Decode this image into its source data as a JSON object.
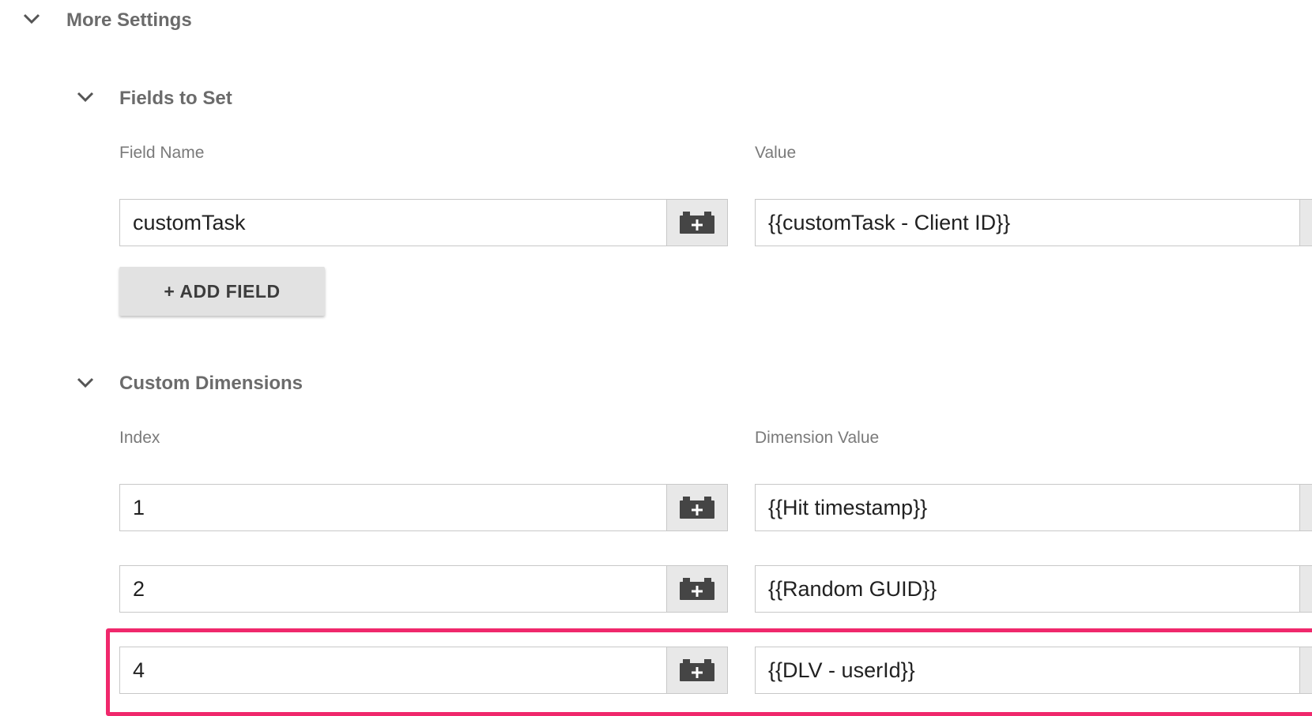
{
  "more_settings": {
    "title": "More Settings"
  },
  "fields_to_set": {
    "title": "Fields to Set",
    "col_name_label": "Field Name",
    "col_value_label": "Value",
    "rows": [
      {
        "name": "customTask",
        "value": "{{customTask - Client ID}}"
      }
    ],
    "add_button_label": "+ ADD FIELD"
  },
  "custom_dimensions": {
    "title": "Custom Dimensions",
    "col_index_label": "Index",
    "col_value_label": "Dimension Value",
    "rows": [
      {
        "index": "1",
        "value": "{{Hit timestamp}}"
      },
      {
        "index": "2",
        "value": "{{Random GUID}}"
      },
      {
        "index": "4",
        "value": "{{DLV - userId}}"
      }
    ]
  },
  "colors": {
    "highlight_border": "#f0286c",
    "picker_bg": "#e8e8e8",
    "section_title": "#6b6b6b"
  },
  "icons": {
    "chevron": "chevron-down-icon",
    "variable_picker": "variable-brick-plus-icon"
  }
}
